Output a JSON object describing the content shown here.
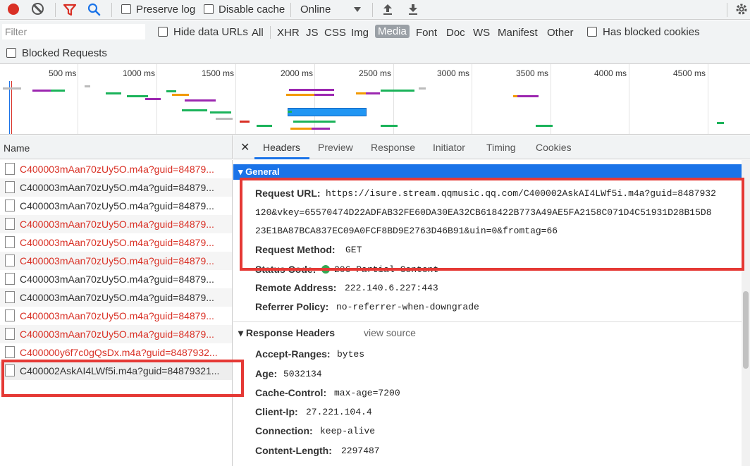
{
  "toolbar": {
    "preserve_log": "Preserve log",
    "disable_cache": "Disable cache",
    "throttle": "Online"
  },
  "filterbar": {
    "filter_placeholder": "Filter",
    "hide_data_urls": "Hide data URLs",
    "types": [
      "All",
      "XHR",
      "JS",
      "CSS",
      "Img",
      "Media",
      "Font",
      "Doc",
      "WS",
      "Manifest",
      "Other"
    ],
    "active_type": "Media",
    "has_blocked_cookies": "Has blocked cookies",
    "blocked_requests": "Blocked Requests"
  },
  "overview": {
    "ticks": [
      "500 ms",
      "1000 ms",
      "1500 ms",
      "2000 ms",
      "2500 ms",
      "3000 ms",
      "3500 ms",
      "4000 ms",
      "4500 ms"
    ]
  },
  "requests": {
    "column_name": "Name",
    "rows": [
      {
        "name": "C400003mAan70zUy5O.m4a?guid=84879...",
        "failed": true
      },
      {
        "name": "C400003mAan70zUy5O.m4a?guid=84879...",
        "failed": false
      },
      {
        "name": "C400003mAan70zUy5O.m4a?guid=84879...",
        "failed": false
      },
      {
        "name": "C400003mAan70zUy5O.m4a?guid=84879...",
        "failed": true
      },
      {
        "name": "C400003mAan70zUy5O.m4a?guid=84879...",
        "failed": true
      },
      {
        "name": "C400003mAan70zUy5O.m4a?guid=84879...",
        "failed": true
      },
      {
        "name": "C400003mAan70zUy5O.m4a?guid=84879...",
        "failed": false
      },
      {
        "name": "C400003mAan70zUy5O.m4a?guid=84879...",
        "failed": false
      },
      {
        "name": "C400003mAan70zUy5O.m4a?guid=84879...",
        "failed": true
      },
      {
        "name": "C400003mAan70zUy5O.m4a?guid=84879...",
        "failed": true
      },
      {
        "name": "C400000y6f7c0gQsDx.m4a?guid=8487932...",
        "failed": true
      },
      {
        "name": "C400002AskAI4LWf5i.m4a?guid=84879321...",
        "failed": false
      }
    ]
  },
  "details": {
    "tabs": [
      "Headers",
      "Preview",
      "Response",
      "Initiator",
      "Timing",
      "Cookies"
    ],
    "active_tab": "Headers",
    "general": {
      "title": "General",
      "request_url_label": "Request URL:",
      "request_url_lines": [
        "https://isure.stream.qqmusic.qq.com/C400002AskAI4LWf5i.m4a?guid=8487932",
        "120&vkey=65570474D22ADFAB32FE60DA30EA32CB618422B773A49AE5FA2158C071D4C51931D28B15D8",
        "23E1BA87BCA837EC09A0FCF8BD9E2763D46B91&uin=0&fromtag=66"
      ],
      "request_method_label": "Request Method:",
      "request_method": "GET",
      "status_code_label": "Status Code:",
      "status_code": "206 Partial Content",
      "remote_address_label": "Remote Address:",
      "remote_address": "222.140.6.227:443",
      "referrer_policy_label": "Referrer Policy:",
      "referrer_policy": "no-referrer-when-downgrade"
    },
    "response_headers": {
      "title": "Response Headers",
      "view_source": "view source",
      "items": [
        {
          "key": "Accept-Ranges:",
          "value": "bytes"
        },
        {
          "key": "Age:",
          "value": "5032134"
        },
        {
          "key": "Cache-Control:",
          "value": "max-age=7200"
        },
        {
          "key": "Client-Ip:",
          "value": "27.221.104.4"
        },
        {
          "key": "Connection:",
          "value": "keep-alive"
        },
        {
          "key": "Content-Length:",
          "value": "2297487"
        }
      ]
    }
  }
}
